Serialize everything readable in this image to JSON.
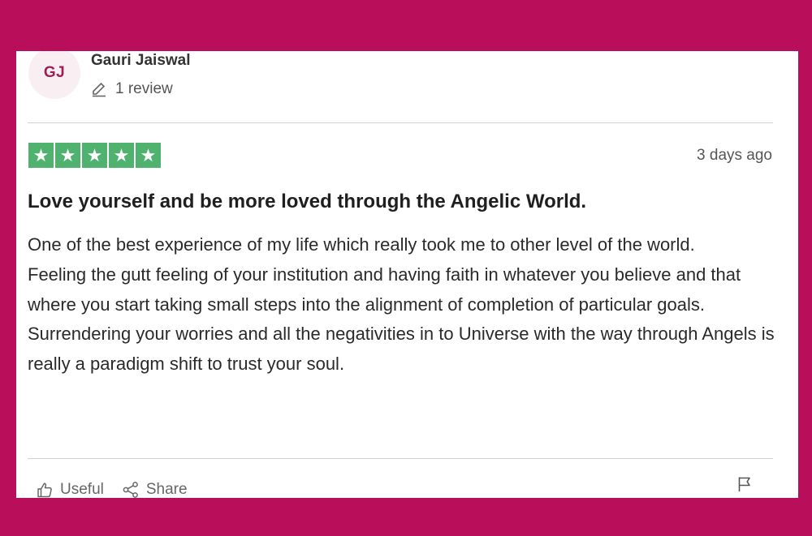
{
  "reviewer": {
    "initials": "GJ",
    "name": "Gauri Jaiswal",
    "review_count": "1 review"
  },
  "review": {
    "rating": 5,
    "rating_max": 5,
    "star_glyph": "★",
    "date": "3 days ago",
    "title": "Love yourself and be more loved through the Angelic World.",
    "paragraphs": [
      "One of the best experience of my life which really took me to other level of the world.",
      "Feeling the gutt feeling of your institution and having faith in whatever you believe and that where you start taking small steps into the alignment of completion of particular goals.",
      "Surrendering your worries and all the negativities in to Universe with the way through Angels is really a paradigm shift to trust your soul."
    ]
  },
  "actions": {
    "useful_label": "Useful",
    "share_label": "Share"
  },
  "colors": {
    "background": "#b90f5a",
    "star_green": "#4fb36f",
    "avatar_bg": "#f9eff2",
    "avatar_text": "#9a2056"
  },
  "icons": {
    "review_count": "pencil-icon",
    "useful": "thumbs-up-icon",
    "share": "share-icon",
    "report": "flag-icon"
  }
}
